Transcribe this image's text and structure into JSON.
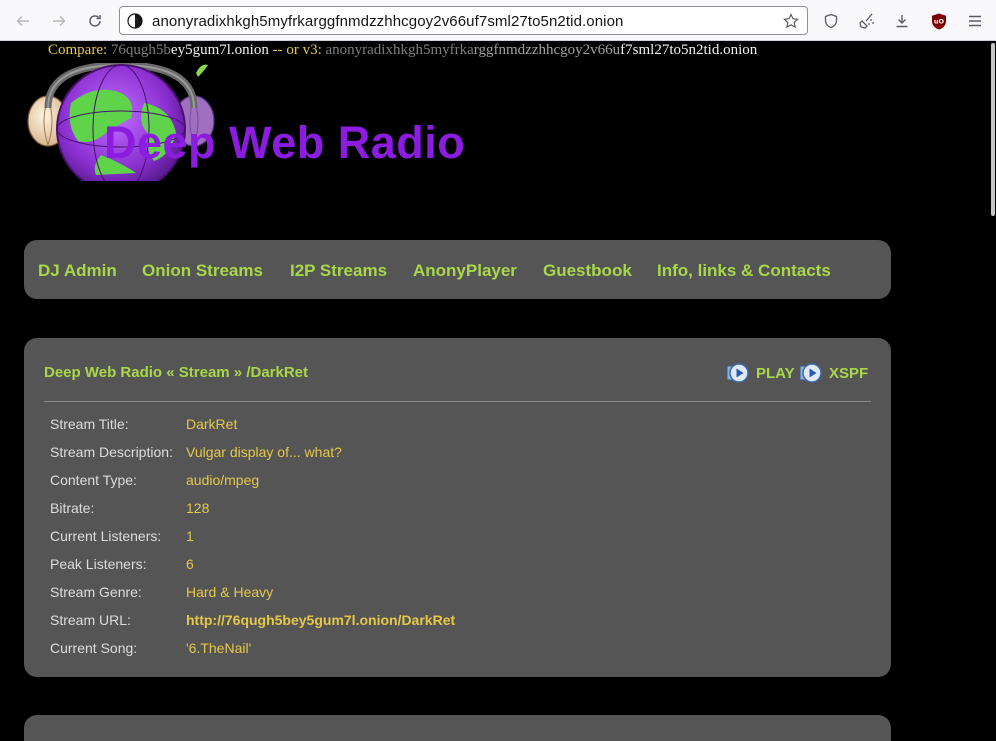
{
  "browser": {
    "url": "anonyradixhkgh5myfrkarggfnmdzzhhcgoy2v66uf7sml27to5n2tid.onion"
  },
  "compare": {
    "label": "Compare:",
    "v2_dim": "76qugh5b",
    "v2_bright": "ey5gum7l",
    "v2_suffix": ".onion",
    "sep": " -- or v3: ",
    "v3_dim": "anonyradixhkgh5myfrka",
    "v3_mid": "rggfnmdzzhhcgoy2v66u",
    "v3_bright": "f7sml27to5n2tid.onion"
  },
  "site": {
    "title": "Deep Web Radio"
  },
  "nav": {
    "items": [
      "DJ Admin",
      "Onion Streams",
      "I2P Streams",
      "AnonyPlayer",
      "Guestbook",
      "Info, links & Contacts"
    ]
  },
  "stream": {
    "breadcrumb": {
      "home": "Deep Web Radio",
      "sep1": " « ",
      "section": "Stream",
      "sep2": " » ",
      "mount": "/DarkRet"
    },
    "actions": {
      "play": "PLAY",
      "xspf": "XSPF"
    },
    "fields": [
      {
        "label": "Stream Title:",
        "value": "DarkRet"
      },
      {
        "label": "Stream Description:",
        "value": "Vulgar display of... what?"
      },
      {
        "label": "Content Type:",
        "value": "audio/mpeg"
      },
      {
        "label": "Bitrate:",
        "value": "128"
      },
      {
        "label": "Current Listeners:",
        "value": "1"
      },
      {
        "label": "Peak Listeners:",
        "value": "6"
      },
      {
        "label": "Stream Genre:",
        "value": "Hard & Heavy"
      },
      {
        "label": "Stream URL:",
        "value": "http://76qugh5bey5gum7l.onion/DarkRet"
      },
      {
        "label": "Current Song:",
        "value": "'6.TheNail'"
      }
    ]
  }
}
